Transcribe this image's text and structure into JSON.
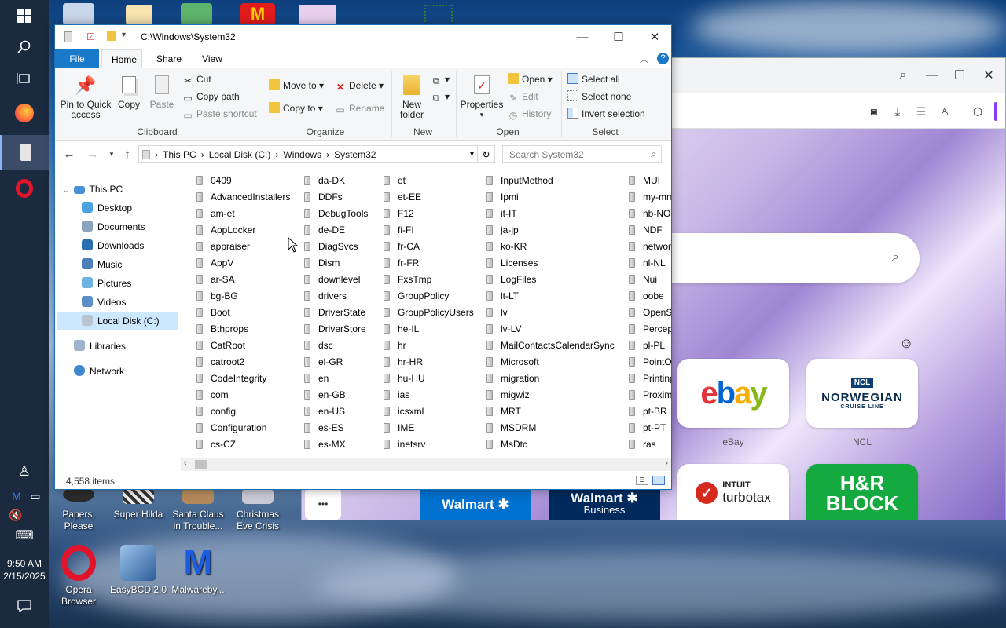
{
  "taskbar": {
    "icons": [
      "windows-start-icon",
      "search-icon",
      "task-view-icon",
      "firefox-icon",
      "file-explorer-icon",
      "opera-icon"
    ],
    "tray_icons": [
      "people-icon",
      "malwarebytes-icon",
      "network-icon",
      "volume-muted-icon",
      "keyboard-icon"
    ],
    "time": "9:50 AM",
    "date": "2/15/2025",
    "notification_icon": "action-center-icon"
  },
  "desktop": {
    "icons": [
      {
        "label": "Papers, Please"
      },
      {
        "label": "Super Hilda"
      },
      {
        "label": "Santa Claus in Trouble..."
      },
      {
        "label": "Christmas Eve Crisis"
      },
      {
        "label": "Opera Browser"
      },
      {
        "label": "EasyBCD 2.0"
      },
      {
        "label": "Malwareby..."
      }
    ]
  },
  "browser": {
    "tiles": [
      {
        "brand": "ebay",
        "label": "eBay"
      },
      {
        "brand": "NORWEGIAN",
        "sub": "CRUISE LINE",
        "badge": "NCL",
        "label": "NCL"
      },
      {
        "brand": "turbotax",
        "prefix": "INTUIT"
      },
      {
        "brand": "H&R BLOCK"
      }
    ],
    "ads": [
      {
        "text": "Walmart ✱"
      },
      {
        "text": "Walmart ✱",
        "sub": "Business"
      }
    ],
    "more_label": "•••"
  },
  "explorer": {
    "title_path": "C:\\Windows\\System32",
    "tabs": [
      "File",
      "Home",
      "Share",
      "View"
    ],
    "ribbon": {
      "clipboard": {
        "pin": "Pin to Quick access",
        "copy": "Copy",
        "paste": "Paste",
        "cut": "Cut",
        "copy_path": "Copy path",
        "paste_shortcut": "Paste shortcut",
        "label": "Clipboard"
      },
      "organize": {
        "move_to": "Move to",
        "copy_to": "Copy to",
        "delete": "Delete",
        "rename": "Rename",
        "label": "Organize"
      },
      "new": {
        "new_folder": "New folder",
        "label": "New"
      },
      "open": {
        "properties": "Properties",
        "open": "Open",
        "edit": "Edit",
        "history": "History",
        "label": "Open"
      },
      "select": {
        "select_all": "Select all",
        "select_none": "Select none",
        "invert": "Invert selection",
        "label": "Select"
      }
    },
    "address": {
      "crumbs": [
        "This PC",
        "Local Disk (C:)",
        "Windows",
        "System32"
      ],
      "search_placeholder": "Search System32"
    },
    "nav": {
      "this_pc": "This PC",
      "items": [
        "Desktop",
        "Documents",
        "Downloads",
        "Music",
        "Pictures",
        "Videos",
        "Local Disk (C:)"
      ],
      "libraries": "Libraries",
      "network": "Network"
    },
    "columns": [
      [
        "0409",
        "AdvancedInstallers",
        "am-et",
        "AppLocker",
        "appraiser",
        "AppV",
        "ar-SA",
        "bg-BG",
        "Boot",
        "Bthprops",
        "CatRoot",
        "catroot2",
        "CodeIntegrity",
        "com",
        "config",
        "Configuration",
        "cs-CZ"
      ],
      [
        "da-DK",
        "DDFs",
        "DebugTools",
        "de-DE",
        "DiagSvcs",
        "Dism",
        "downlevel",
        "drivers",
        "DriverState",
        "DriverStore",
        "dsc",
        "el-GR",
        "en",
        "en-GB",
        "en-US",
        "es-ES",
        "es-MX"
      ],
      [
        "et",
        "et-EE",
        "F12",
        "fi-FI",
        "fr-CA",
        "fr-FR",
        "FxsTmp",
        "GroupPolicy",
        "GroupPolicyUsers",
        "he-IL",
        "hr",
        "hr-HR",
        "hu-HU",
        "ias",
        "icsxml",
        "IME",
        "inetsrv"
      ],
      [
        "InputMethod",
        "Ipmi",
        "it-IT",
        "ja-jp",
        "ko-KR",
        "Licenses",
        "LogFiles",
        "lt-LT",
        "lv",
        "lv-LV",
        "MailContactsCalendarSync",
        "Microsoft",
        "migration",
        "migwiz",
        "MRT",
        "MSDRM",
        "MsDtc"
      ],
      [
        "MUI",
        "my-mm",
        "nb-NO",
        "NDF",
        "network",
        "nl-NL",
        "Nui",
        "oobe",
        "OpenSSH",
        "Percept",
        "pl-PL",
        "PointOf",
        "Printing",
        "Proximi",
        "pt-BR",
        "pt-PT",
        "ras"
      ]
    ],
    "status": "4,558 items"
  }
}
